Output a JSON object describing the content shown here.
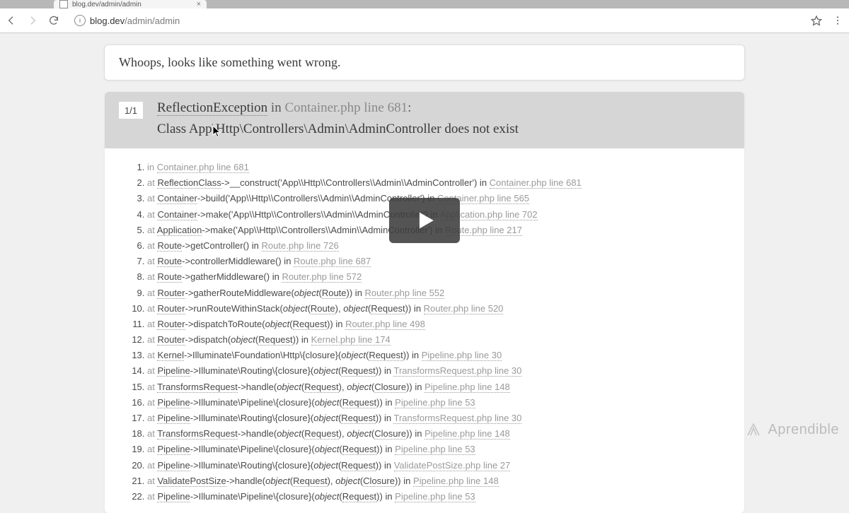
{
  "browser": {
    "tab_title": "blog.dev/admin/admin",
    "url_host": "blog.dev",
    "url_path": "/admin/admin"
  },
  "whoops": "Whoops, looks like something went wrong.",
  "error": {
    "counter": "1/1",
    "exception": "ReflectionException",
    "in_word": " in ",
    "file_ref": "Container.php line 681",
    "colon": ":",
    "message": "Class App\\Http\\Controllers\\Admin\\AdminController does not exist"
  },
  "trace": [
    {
      "pre": "in ",
      "loc": "Container.php line 681"
    },
    {
      "pre": "at ",
      "cls": "ReflectionClass",
      "mid": "->__construct('App\\\\Http\\\\Controllers\\\\Admin\\\\AdminController') in ",
      "loc": "Container.php line 681"
    },
    {
      "pre": "at ",
      "cls": "Container",
      "mid": "->build('App\\\\Http\\\\Controllers\\\\Admin\\\\AdminController') in ",
      "loc": "Container.php line 565"
    },
    {
      "pre": "at ",
      "cls": "Container",
      "mid": "->make('App\\\\Http\\\\Controllers\\\\Admin\\\\AdminController') in ",
      "loc": "Application.php line 702"
    },
    {
      "pre": "at ",
      "cls": "Application",
      "mid": "->make('App\\\\Http\\\\Controllers\\\\Admin\\\\AdminController') in ",
      "loc": "Route.php line 217"
    },
    {
      "pre": "at ",
      "cls": "Route",
      "mid": "->getController() in ",
      "loc": "Route.php line 726"
    },
    {
      "pre": "at ",
      "cls": "Route",
      "mid": "->controllerMiddleware() in ",
      "loc": "Route.php line 687"
    },
    {
      "pre": "at ",
      "cls": "Route",
      "mid": "->gatherMiddleware() in ",
      "loc": "Router.php line 572"
    },
    {
      "pre": "at ",
      "cls": "Router",
      "mid_html": "->gatherRouteMiddleware(<span class='tk-em'>object</span>(<span class='tk-uline'>Route</span>)) in ",
      "loc": "Router.php line 552"
    },
    {
      "pre": "at ",
      "cls": "Router",
      "mid_html": "->runRouteWithinStack(<span class='tk-em'>object</span>(<span class='tk-uline'>Route</span>), <span class='tk-em'>object</span>(<span class='tk-uline'>Request</span>)) in ",
      "loc": "Router.php line 520"
    },
    {
      "pre": "at ",
      "cls": "Router",
      "mid_html": "->dispatchToRoute(<span class='tk-em'>object</span>(<span class='tk-uline'>Request</span>)) in ",
      "loc": "Router.php line 498"
    },
    {
      "pre": "at ",
      "cls": "Router",
      "mid_html": "->dispatch(<span class='tk-em'>object</span>(<span class='tk-uline'>Request</span>)) in ",
      "loc": "Kernel.php line 174"
    },
    {
      "pre": "at ",
      "cls": "Kernel",
      "mid_html": "->Illuminate\\Foundation\\Http\\{closure}(<span class='tk-em'>object</span>(<span class='tk-uline'>Request</span>)) in ",
      "loc": "Pipeline.php line 30"
    },
    {
      "pre": "at ",
      "cls": "Pipeline",
      "mid_html": "->Illuminate\\Routing\\{closure}(<span class='tk-em'>object</span>(<span class='tk-uline'>Request</span>)) in ",
      "loc": "TransformsRequest.php line 30"
    },
    {
      "pre": "at ",
      "cls": "TransformsRequest",
      "mid_html": "->handle(<span class='tk-em'>object</span>(<span class='tk-uline'>Request</span>), <span class='tk-em'>object</span>(<span class='tk-uline'>Closure</span>)) in ",
      "loc": "Pipeline.php line 148"
    },
    {
      "pre": "at ",
      "cls": "Pipeline",
      "mid_html": "->Illuminate\\Pipeline\\{closure}(<span class='tk-em'>object</span>(<span class='tk-uline'>Request</span>)) in ",
      "loc": "Pipeline.php line 53"
    },
    {
      "pre": "at ",
      "cls": "Pipeline",
      "mid_html": "->Illuminate\\Routing\\{closure}(<span class='tk-em'>object</span>(<span class='tk-uline'>Request</span>)) in ",
      "loc": "TransformsRequest.php line 30"
    },
    {
      "pre": "at ",
      "cls": "TransformsRequest",
      "mid_html": "->handle(<span class='tk-em'>object</span>(<span class='tk-uline'>Request</span>), <span class='tk-em'>object</span>(<span class='tk-uline'>Closure</span>)) in ",
      "loc": "Pipeline.php line 148"
    },
    {
      "pre": "at ",
      "cls": "Pipeline",
      "mid_html": "->Illuminate\\Pipeline\\{closure}(<span class='tk-em'>object</span>(<span class='tk-uline'>Request</span>)) in ",
      "loc": "Pipeline.php line 53"
    },
    {
      "pre": "at ",
      "cls": "Pipeline",
      "mid_html": "->Illuminate\\Routing\\{closure}(<span class='tk-em'>object</span>(<span class='tk-uline'>Request</span>)) in ",
      "loc": "ValidatePostSize.php line 27"
    },
    {
      "pre": "at ",
      "cls": "ValidatePostSize",
      "mid_html": "->handle(<span class='tk-em'>object</span>(<span class='tk-uline'>Request</span>), <span class='tk-em'>object</span>(<span class='tk-uline'>Closure</span>)) in ",
      "loc": "Pipeline.php line 148"
    },
    {
      "pre": "at ",
      "cls": "Pipeline",
      "mid_html": "->Illuminate\\Pipeline\\{closure}(<span class='tk-em'>object</span>(<span class='tk-uline'>Request</span>)) in ",
      "loc": "Pipeline.php line 53"
    }
  ],
  "watermark": "Aprendible"
}
